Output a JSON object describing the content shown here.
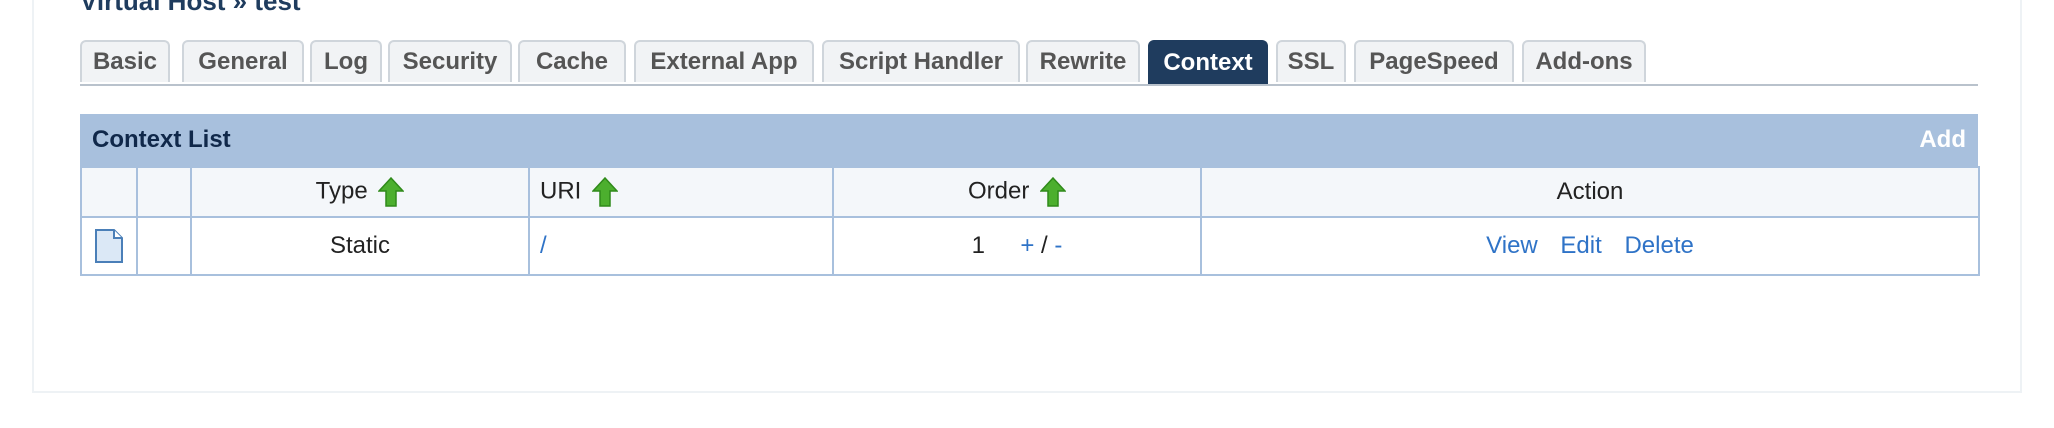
{
  "page": {
    "title": "Virtual Host » test"
  },
  "tabs": [
    {
      "label": "Basic"
    },
    {
      "label": "General"
    },
    {
      "label": "Log"
    },
    {
      "label": "Security"
    },
    {
      "label": "Cache"
    },
    {
      "label": "External App"
    },
    {
      "label": "Script Handler"
    },
    {
      "label": "Rewrite"
    },
    {
      "label": "Context"
    },
    {
      "label": "SSL"
    },
    {
      "label": "PageSpeed"
    },
    {
      "label": "Add-ons"
    }
  ],
  "active_tab": "Context",
  "context_list": {
    "title": "Context List",
    "add_label": "Add",
    "columns": {
      "type": "Type",
      "uri": "URI",
      "order": "Order",
      "action": "Action"
    },
    "rows": [
      {
        "icon": "document-icon",
        "type": "Static",
        "uri": "/",
        "order": "1",
        "order_up": "+",
        "order_sep": "/",
        "order_down": "-",
        "actions": {
          "view": "View",
          "edit": "Edit",
          "delete": "Delete"
        }
      }
    ]
  },
  "colors": {
    "accent": "#1f3c5e",
    "header_bar": "#a8c0dd",
    "link": "#2f73c7",
    "sort_arrow": "#4caf2e"
  }
}
